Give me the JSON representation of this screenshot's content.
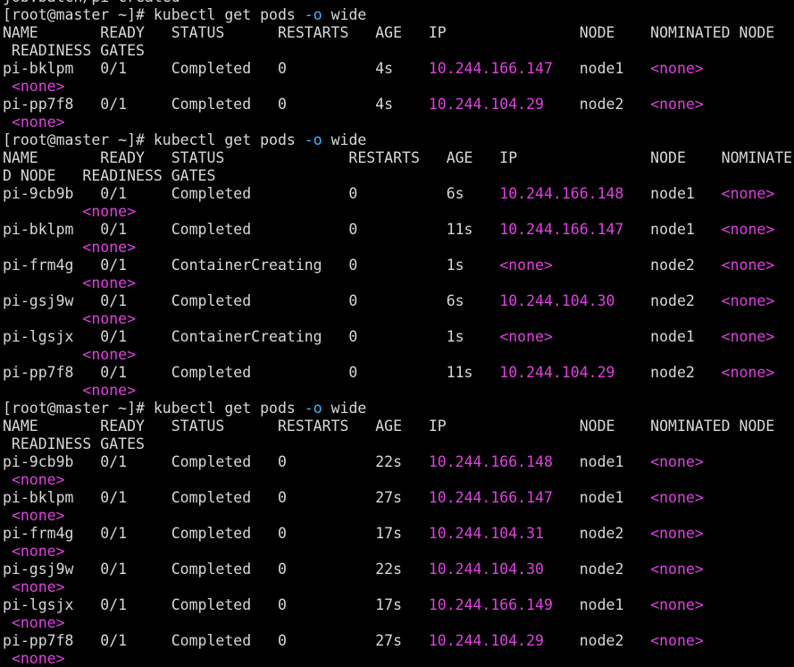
{
  "terminal": {
    "colors": {
      "background": "#000000",
      "text": "#d8d8d8",
      "highlight": "#e040e0",
      "option": "#3db7ff"
    },
    "lines": [
      [
        {
          "t": "job.batch/pi created"
        }
      ],
      [
        {
          "t": "[root@master ~]# kubectl get pods "
        },
        {
          "t": "-o",
          "c": "opt"
        },
        {
          "t": " wide"
        }
      ],
      [
        {
          "t": "NAME       READY   STATUS      RESTARTS   AGE   IP               NODE    NOMINATED NODE"
        }
      ],
      [
        {
          "t": " READINESS GATES"
        }
      ],
      [
        {
          "t": "pi-bklpm   0/1     Completed   0          4s    "
        },
        {
          "t": "10.244.166.147",
          "c": "hl"
        },
        {
          "t": "   node1   "
        },
        {
          "t": "<none>",
          "c": "hl"
        }
      ],
      [
        {
          "t": " "
        },
        {
          "t": "<none>",
          "c": "hl"
        }
      ],
      [
        {
          "t": "pi-pp7f8   0/1     Completed   0          4s    "
        },
        {
          "t": "10.244.104.29",
          "c": "hl"
        },
        {
          "t": "    node2   "
        },
        {
          "t": "<none>",
          "c": "hl"
        }
      ],
      [
        {
          "t": " "
        },
        {
          "t": "<none>",
          "c": "hl"
        }
      ],
      [
        {
          "t": "[root@master ~]# kubectl get pods "
        },
        {
          "t": "-o",
          "c": "opt"
        },
        {
          "t": " wide"
        }
      ],
      [
        {
          "t": "NAME       READY   STATUS              RESTARTS   AGE   IP               NODE    NOMINATE"
        }
      ],
      [
        {
          "t": "D NODE   READINESS GATES"
        }
      ],
      [
        {
          "t": "pi-9cb9b   0/1     Completed           0          6s    "
        },
        {
          "t": "10.244.166.148",
          "c": "hl"
        },
        {
          "t": "   node1   "
        },
        {
          "t": "<none>",
          "c": "hl"
        }
      ],
      [
        {
          "t": "         "
        },
        {
          "t": "<none>",
          "c": "hl"
        }
      ],
      [
        {
          "t": "pi-bklpm   0/1     Completed           0          11s   "
        },
        {
          "t": "10.244.166.147",
          "c": "hl"
        },
        {
          "t": "   node1   "
        },
        {
          "t": "<none>",
          "c": "hl"
        }
      ],
      [
        {
          "t": "         "
        },
        {
          "t": "<none>",
          "c": "hl"
        }
      ],
      [
        {
          "t": "pi-frm4g   0/1     ContainerCreating   0          1s    "
        },
        {
          "t": "<none>",
          "c": "hl"
        },
        {
          "t": "           node2   "
        },
        {
          "t": "<none>",
          "c": "hl"
        }
      ],
      [
        {
          "t": "         "
        },
        {
          "t": "<none>",
          "c": "hl"
        }
      ],
      [
        {
          "t": "pi-gsj9w   0/1     Completed           0          6s    "
        },
        {
          "t": "10.244.104.30",
          "c": "hl"
        },
        {
          "t": "    node2   "
        },
        {
          "t": "<none>",
          "c": "hl"
        }
      ],
      [
        {
          "t": "         "
        },
        {
          "t": "<none>",
          "c": "hl"
        }
      ],
      [
        {
          "t": "pi-lgsjx   0/1     ContainerCreating   0          1s    "
        },
        {
          "t": "<none>",
          "c": "hl"
        },
        {
          "t": "           node1   "
        },
        {
          "t": "<none>",
          "c": "hl"
        }
      ],
      [
        {
          "t": "         "
        },
        {
          "t": "<none>",
          "c": "hl"
        }
      ],
      [
        {
          "t": "pi-pp7f8   0/1     Completed           0          11s   "
        },
        {
          "t": "10.244.104.29",
          "c": "hl"
        },
        {
          "t": "    node2   "
        },
        {
          "t": "<none>",
          "c": "hl"
        }
      ],
      [
        {
          "t": "         "
        },
        {
          "t": "<none>",
          "c": "hl"
        }
      ],
      [
        {
          "t": "[root@master ~]# kubectl get pods "
        },
        {
          "t": "-o",
          "c": "opt"
        },
        {
          "t": " wide"
        }
      ],
      [
        {
          "t": "NAME       READY   STATUS      RESTARTS   AGE   IP               NODE    NOMINATED NODE"
        }
      ],
      [
        {
          "t": " READINESS GATES"
        }
      ],
      [
        {
          "t": "pi-9cb9b   0/1     Completed   0          22s   "
        },
        {
          "t": "10.244.166.148",
          "c": "hl"
        },
        {
          "t": "   node1   "
        },
        {
          "t": "<none>",
          "c": "hl"
        }
      ],
      [
        {
          "t": " "
        },
        {
          "t": "<none>",
          "c": "hl"
        }
      ],
      [
        {
          "t": "pi-bklpm   0/1     Completed   0          27s   "
        },
        {
          "t": "10.244.166.147",
          "c": "hl"
        },
        {
          "t": "   node1   "
        },
        {
          "t": "<none>",
          "c": "hl"
        }
      ],
      [
        {
          "t": " "
        },
        {
          "t": "<none>",
          "c": "hl"
        }
      ],
      [
        {
          "t": "pi-frm4g   0/1     Completed   0          17s   "
        },
        {
          "t": "10.244.104.31",
          "c": "hl"
        },
        {
          "t": "    node2   "
        },
        {
          "t": "<none>",
          "c": "hl"
        }
      ],
      [
        {
          "t": " "
        },
        {
          "t": "<none>",
          "c": "hl"
        }
      ],
      [
        {
          "t": "pi-gsj9w   0/1     Completed   0          22s   "
        },
        {
          "t": "10.244.104.30",
          "c": "hl"
        },
        {
          "t": "    node2   "
        },
        {
          "t": "<none>",
          "c": "hl"
        }
      ],
      [
        {
          "t": " "
        },
        {
          "t": "<none>",
          "c": "hl"
        }
      ],
      [
        {
          "t": "pi-lgsjx   0/1     Completed   0          17s   "
        },
        {
          "t": "10.244.166.149",
          "c": "hl"
        },
        {
          "t": "   node1   "
        },
        {
          "t": "<none>",
          "c": "hl"
        }
      ],
      [
        {
          "t": " "
        },
        {
          "t": "<none>",
          "c": "hl"
        }
      ],
      [
        {
          "t": "pi-pp7f8   0/1     Completed   0          27s   "
        },
        {
          "t": "10.244.104.29",
          "c": "hl"
        },
        {
          "t": "    node2   "
        },
        {
          "t": "<none>",
          "c": "hl"
        }
      ],
      [
        {
          "t": " "
        },
        {
          "t": "<none>",
          "c": "hl"
        }
      ]
    ]
  }
}
